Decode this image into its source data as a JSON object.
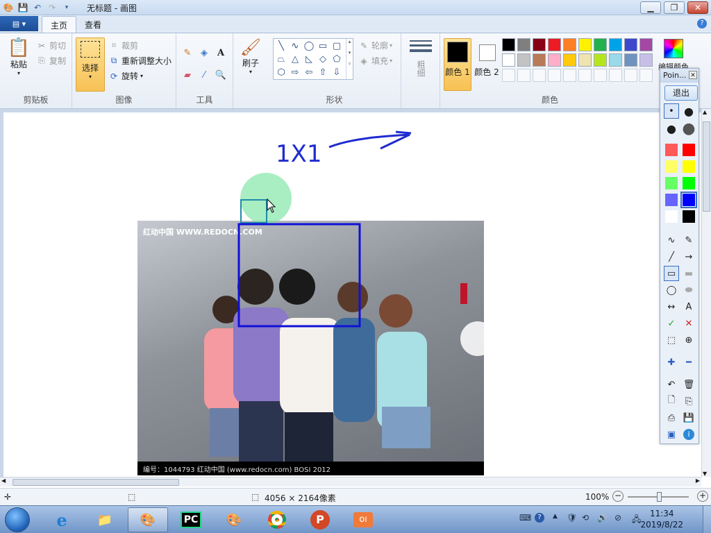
{
  "window": {
    "title": "无标题 - 画图"
  },
  "tabs": [
    {
      "label": "主页"
    },
    {
      "label": "查看"
    }
  ],
  "ribbon": {
    "clipboard": {
      "paste": "粘贴",
      "cut": "剪切",
      "copy": "复制",
      "group": "剪贴板"
    },
    "image": {
      "select": "选择",
      "crop": "裁剪",
      "resize": "重新调整大小",
      "rotate": "旋转",
      "group": "图像"
    },
    "tools": {
      "group": "工具"
    },
    "brushes": {
      "label": "刷子"
    },
    "shapes": {
      "outline": "轮廓",
      "fill": "填充",
      "group": "形状"
    },
    "size": {
      "label": "粗细"
    },
    "colors": {
      "color1": "颜色 1",
      "color2": "颜色 2",
      "edit": "编辑颜色",
      "group": "颜色"
    }
  },
  "palette": {
    "row1": [
      "#000000",
      "#7f7f7f",
      "#880015",
      "#ed1c24",
      "#ff7f27",
      "#fff200",
      "#22b14c",
      "#00a2e8",
      "#3f48cc",
      "#a349a4"
    ],
    "row2": [
      "#ffffff",
      "#c3c3c3",
      "#b97a57",
      "#ffaec9",
      "#ffc90e",
      "#efe4b0",
      "#b5e61d",
      "#99d9ea",
      "#7092be",
      "#c8bfe7"
    ]
  },
  "canvas": {
    "annotation_text": "1X1",
    "photo_caption": "红动中国 WWW.REDOCN.COM",
    "photo_footer": "编号：1044793   红动中国 (www.redocn.com)   BOSI 2012"
  },
  "point_toolbar": {
    "title": "Poin...",
    "exit": "退出",
    "colors": [
      "#ff5a5a",
      "#ff0000",
      "#ffff66",
      "#ffff00",
      "#66ff66",
      "#00ff00",
      "#6666ff",
      "#0000ff",
      "#ffffff",
      "#000000"
    ]
  },
  "statusbar": {
    "dimensions": "4056 × 2164像素",
    "zoom": "100%"
  },
  "taskbar": {
    "time": "11:34",
    "date": "2019/8/22"
  }
}
